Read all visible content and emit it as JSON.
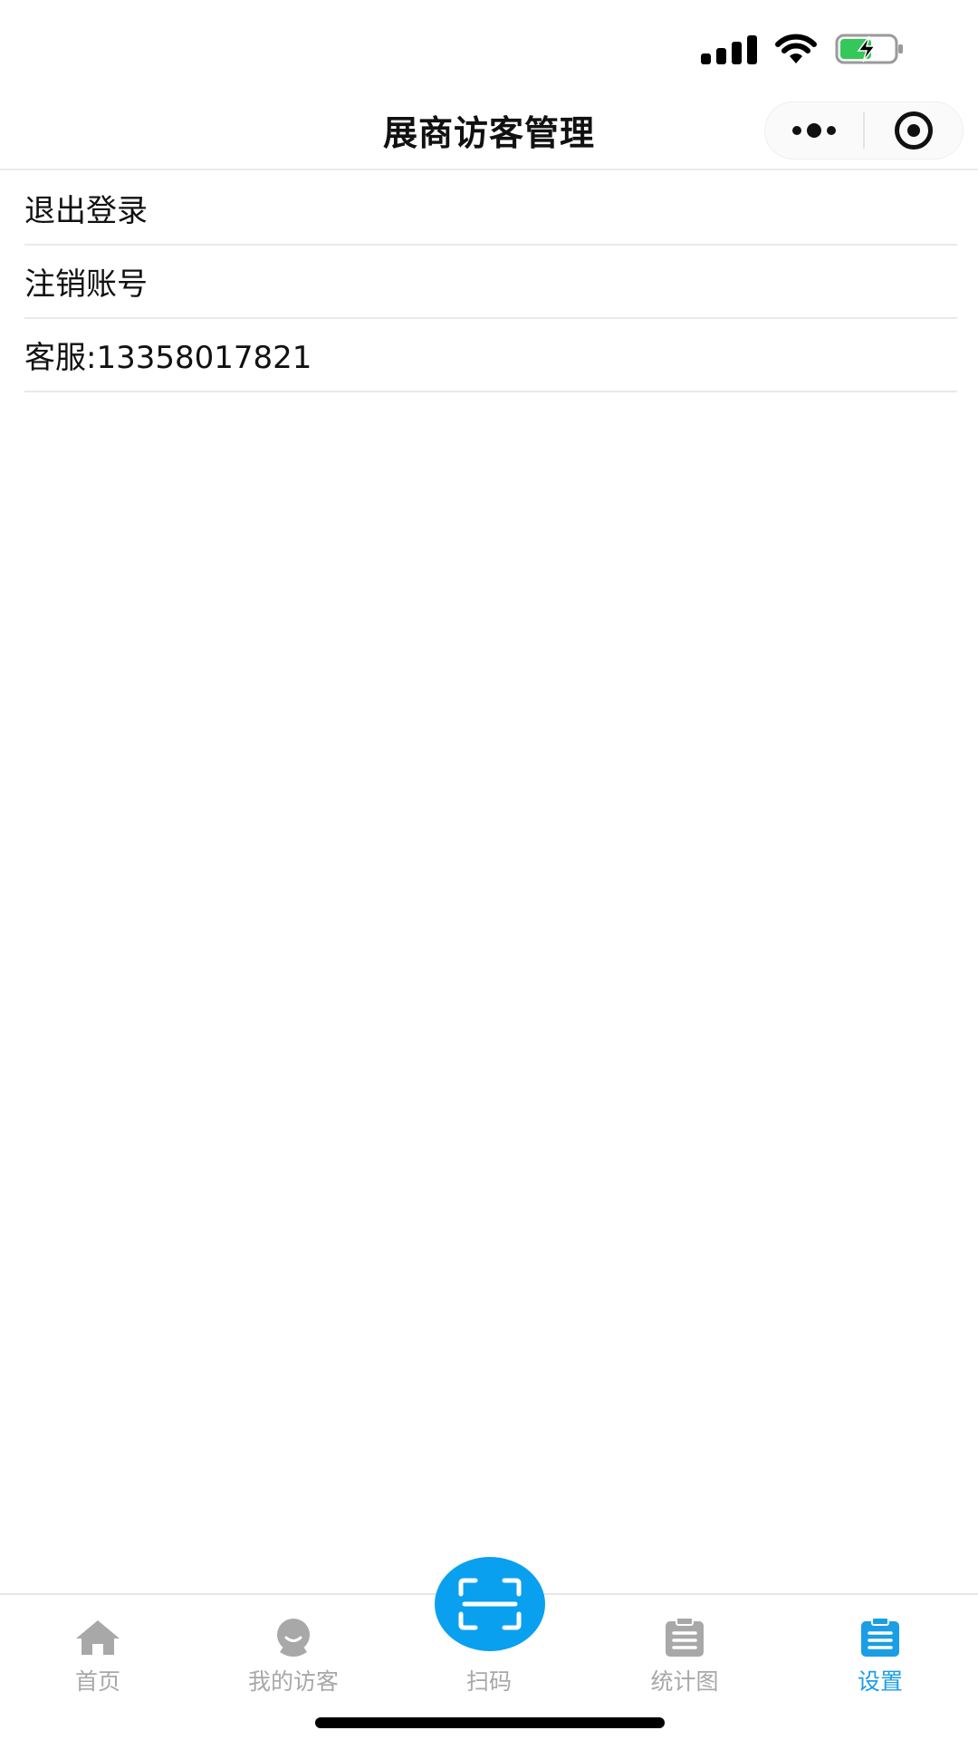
{
  "nav": {
    "title": "展商访客管理"
  },
  "settings": {
    "items": [
      {
        "label": "退出登录"
      },
      {
        "label": "注销账号"
      },
      {
        "label": "客服:13358017821"
      }
    ]
  },
  "tabbar": {
    "tabs": [
      {
        "label": "首页",
        "icon": "home-icon"
      },
      {
        "label": "我的访客",
        "icon": "visitor-icon"
      },
      {
        "label": "扫码",
        "icon": "scan-icon"
      },
      {
        "label": "统计图",
        "icon": "chart-clipboard-icon"
      },
      {
        "label": "设置",
        "icon": "settings-clipboard-icon"
      }
    ],
    "active_index": 4,
    "colors": {
      "active": "#1a9ee6",
      "inactive": "#a8a8a8",
      "scan_button": "#0aa0f0"
    }
  },
  "status_bar": {
    "icons": [
      "signal-icon",
      "wifi-icon",
      "battery-charging-icon"
    ],
    "battery_color": "#34c759"
  }
}
